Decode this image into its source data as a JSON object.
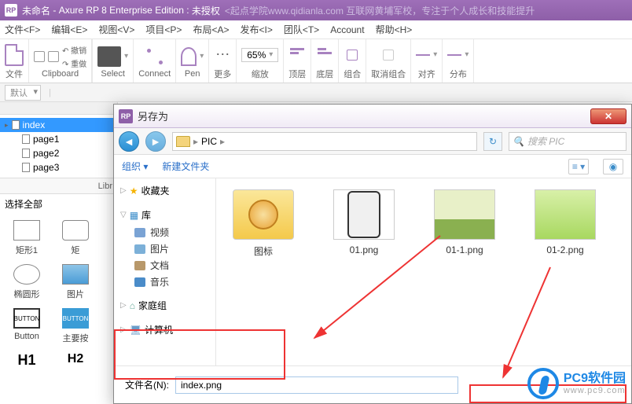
{
  "titlebar": {
    "app_icon": "RP",
    "doc": "未命名",
    "app": "Axure RP 8 Enterprise Edition",
    "lic": "未授权",
    "promo": "<起点学院www.qidianla.com 互联网黄埔军校，专注于个人成长和技能提升"
  },
  "menu": {
    "file": "文件<F>",
    "edit": "编辑<E>",
    "view": "视图<V>",
    "project": "项目<P>",
    "layout": "布局<A>",
    "publish": "发布<I>",
    "team": "团队<T>",
    "account": "Account",
    "help": "帮助<H>"
  },
  "toolbar": {
    "file": "文件",
    "clipboard": "Clipboard",
    "undo": "撤销",
    "redo": "重做",
    "select": "Select",
    "connect": "Connect",
    "pen": "Pen",
    "more": "更多",
    "zoom": "65%",
    "zoom_lbl": "缩放",
    "top": "顶层",
    "bottom": "底层",
    "group": "组合",
    "ungroup": "取消组合",
    "align": "对齐",
    "distribute": "分布"
  },
  "secbar": {
    "default": "默认"
  },
  "sidebar": {
    "pages": [
      {
        "label": "index",
        "selected": true,
        "expandable": true
      },
      {
        "label": "page1"
      },
      {
        "label": "page2"
      },
      {
        "label": "page3"
      }
    ],
    "lib_tab": "Libr",
    "select_all": "选择全部",
    "shapes": {
      "rect": "矩形1",
      "rect2": "矩",
      "ellipse": "椭圆形",
      "img": "图片",
      "button_chip": "BUTTON",
      "button": "Button",
      "primary": "主要按",
      "h1": "H1",
      "h2": "H2"
    }
  },
  "dialog": {
    "title": "另存为",
    "crumb_folder": "PIC",
    "search_placeholder": "搜索 PIC",
    "organize": "组织",
    "newfolder": "新建文件夹",
    "side": {
      "fav": "收藏夹",
      "lib": "库",
      "video": "视频",
      "pic": "图片",
      "doc": "文档",
      "music": "音乐",
      "home": "家庭组",
      "computer": "计算机"
    },
    "files": [
      {
        "name": "图标",
        "kind": "folder"
      },
      {
        "name": "01.png",
        "kind": "phone"
      },
      {
        "name": "01-1.png",
        "kind": "sky"
      },
      {
        "name": "01-2.png",
        "kind": "green"
      }
    ],
    "filename_label": "文件名(N):",
    "filename_value": "index.png"
  },
  "watermark": {
    "line1": "PC9软件园",
    "line2": "www.pc9.com"
  }
}
